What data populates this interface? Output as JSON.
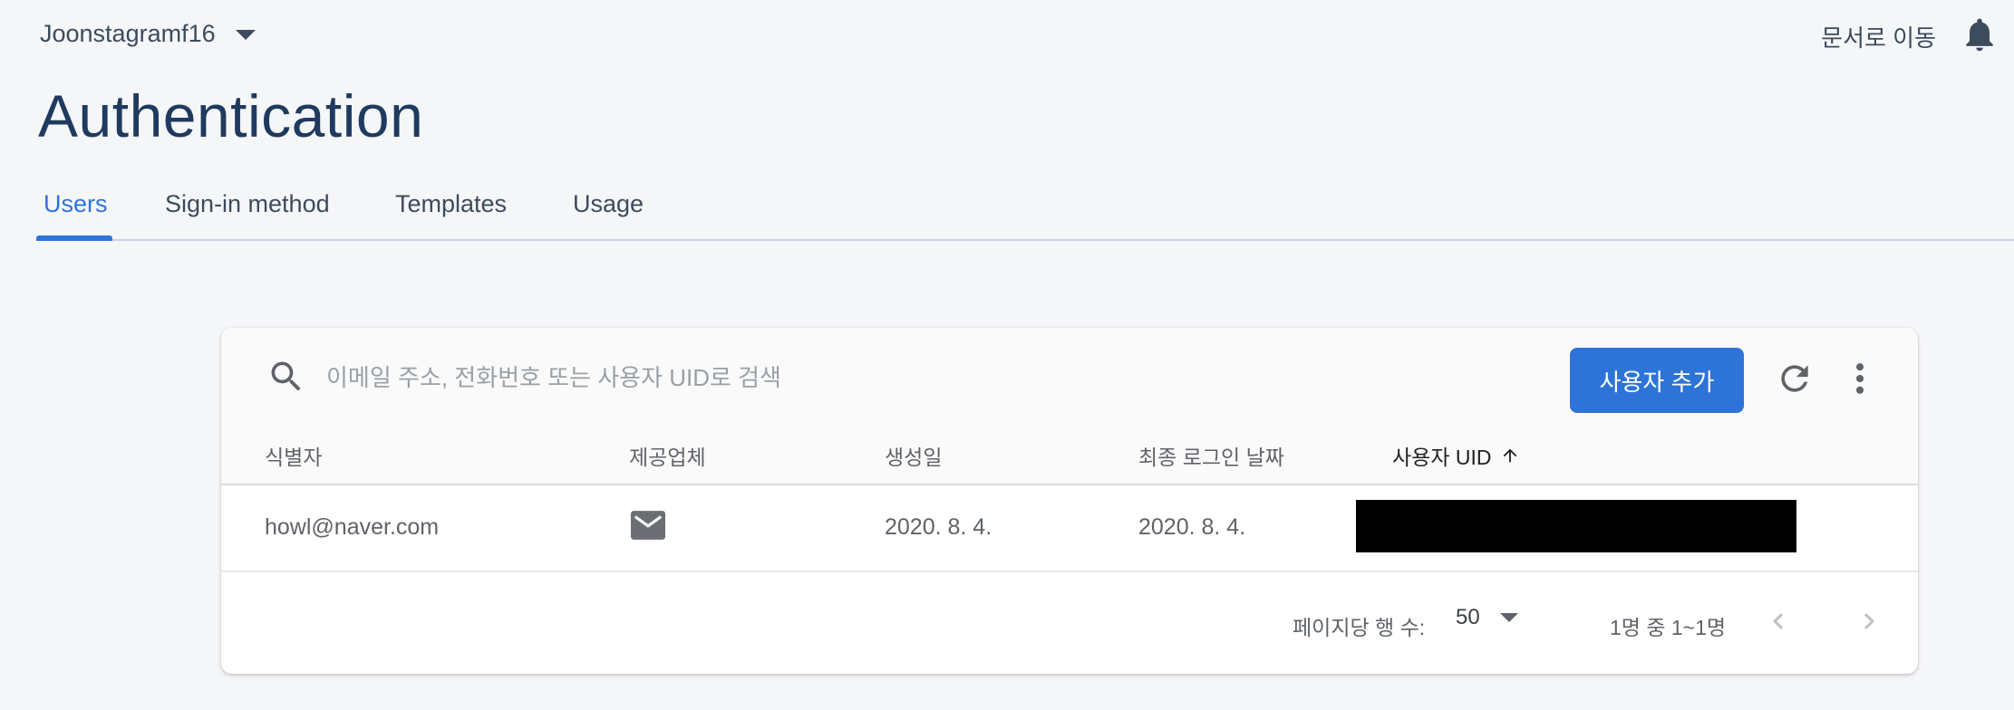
{
  "topbar": {
    "project_name": "Joonstagramf16",
    "docs_link": "문서로 이동"
  },
  "page": {
    "title": "Authentication"
  },
  "tabs": [
    {
      "label": "Users",
      "active": true
    },
    {
      "label": "Sign-in method",
      "active": false
    },
    {
      "label": "Templates",
      "active": false
    },
    {
      "label": "Usage",
      "active": false
    }
  ],
  "search": {
    "placeholder": "이메일 주소, 전화번호 또는 사용자 UID로 검색"
  },
  "toolbar": {
    "add_user_label": "사용자 추가"
  },
  "table": {
    "headers": [
      "식별자",
      "제공업체",
      "생성일",
      "최종 로그인 날짜",
      "사용자 UID"
    ],
    "sorted_column": "사용자 UID",
    "rows": [
      {
        "identifier": "howl@naver.com",
        "provider_icon": "mail-icon",
        "created": "2020. 8. 4.",
        "last_sign_in": "2020. 8. 4.",
        "uid": ""
      }
    ]
  },
  "pagination": {
    "rows_per_page_label": "페이지당 행 수:",
    "rows_per_page_value": "50",
    "range_text": "1명 중 1~1명"
  },
  "colors": {
    "accent": "#2e74d8",
    "title": "#1f3a5f"
  }
}
